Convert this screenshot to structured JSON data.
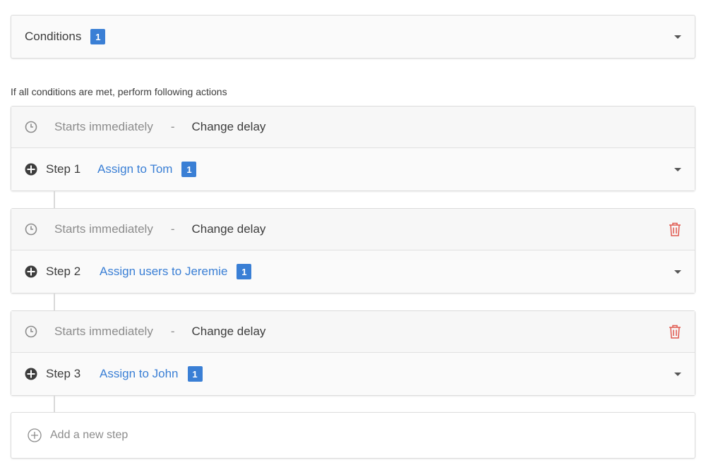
{
  "conditions": {
    "label": "Conditions",
    "count": "1"
  },
  "intro_text": "If all conditions are met, perform following actions",
  "steps": [
    {
      "delay_text": "Starts immediately",
      "separator": "-",
      "change_delay": "Change delay",
      "step_label": "Step 1",
      "action": "Assign to Tom",
      "count": "1",
      "deletable": false
    },
    {
      "delay_text": "Starts immediately",
      "separator": "-",
      "change_delay": "Change delay",
      "step_label": "Step 2",
      "action": "Assign users to Jeremie",
      "count": "1",
      "deletable": true
    },
    {
      "delay_text": "Starts immediately",
      "separator": "-",
      "change_delay": "Change delay",
      "step_label": "Step 3",
      "action": "Assign to John",
      "count": "1",
      "deletable": true
    }
  ],
  "add_step": {
    "label": "Add a new step"
  },
  "colors": {
    "accent": "#3a7fd5",
    "danger": "#e0584f",
    "muted": "#8c8c8c"
  }
}
